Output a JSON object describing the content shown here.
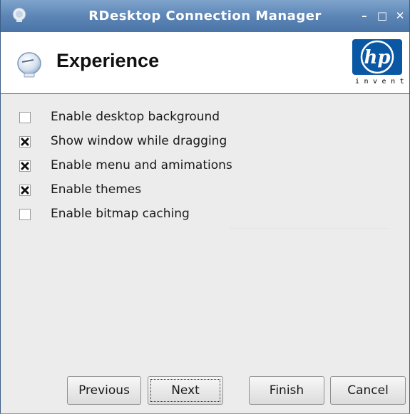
{
  "window": {
    "title": "RDesktop Connection Manager",
    "controls": {
      "minimize": "–",
      "maximize": "□",
      "close": "✕"
    }
  },
  "header": {
    "title": "Experience",
    "logo_text": "hp",
    "logo_tagline": "invent"
  },
  "options": [
    {
      "label": "Enable desktop background",
      "checked": false
    },
    {
      "label": "Show window while dragging",
      "checked": true
    },
    {
      "label": "Enable menu and amimations",
      "checked": true
    },
    {
      "label": "Enable themes",
      "checked": true
    },
    {
      "label": "Enable bitmap caching",
      "checked": false
    }
  ],
  "buttons": {
    "previous": "Previous",
    "next": "Next",
    "finish": "Finish",
    "cancel": "Cancel"
  },
  "colors": {
    "titlebar": "#5d86b6",
    "hp_blue": "#0a57a4"
  }
}
